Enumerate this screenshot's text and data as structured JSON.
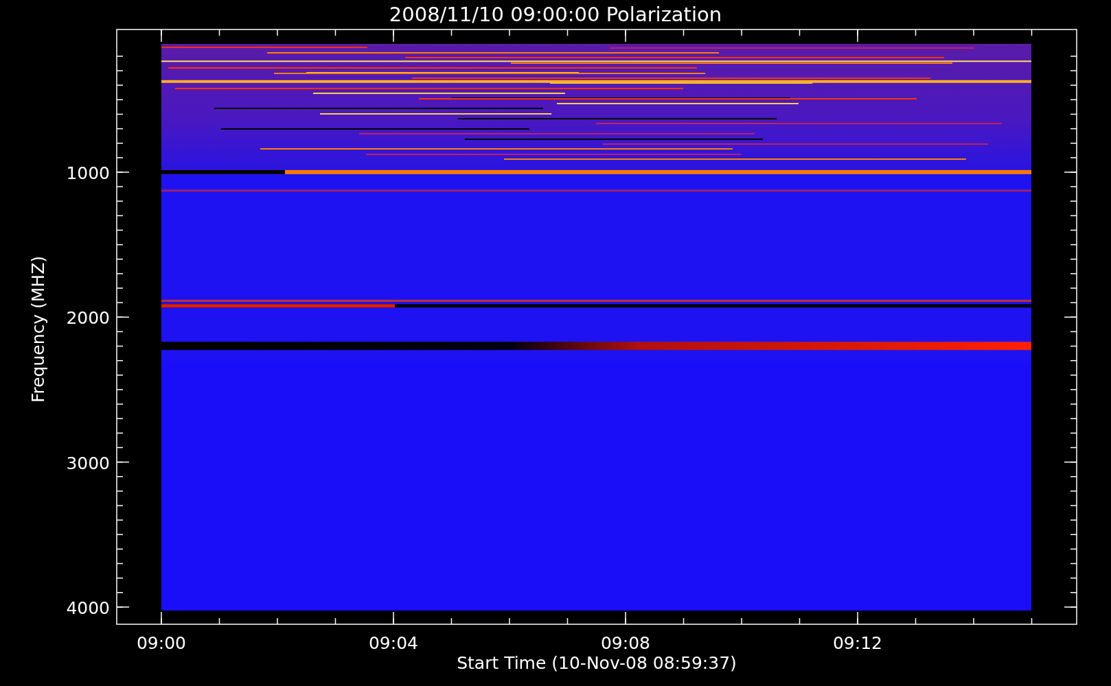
{
  "title": "2008/11/10 09:00:00 Polarization",
  "y_axis": {
    "label": "Frequency (MHZ)",
    "ticks": [
      "1000",
      "2000",
      "3000",
      "4000"
    ]
  },
  "x_axis": {
    "label": "Start Time (10-Nov-08 08:59:37)",
    "ticks": [
      "09:00",
      "09:04",
      "09:08",
      "09:12"
    ]
  }
}
